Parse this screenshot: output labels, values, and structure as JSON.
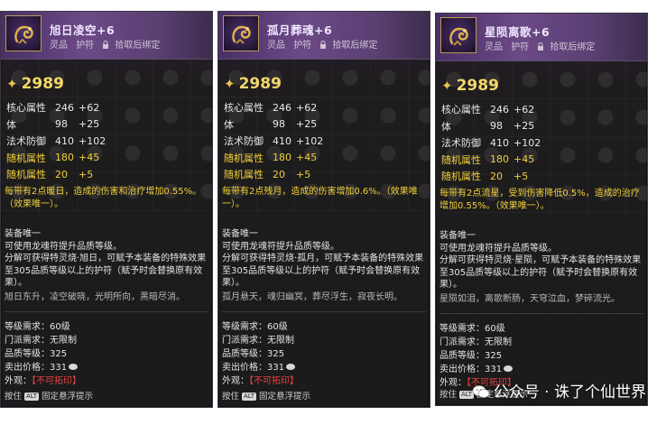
{
  "tooltips": [
    {
      "title": "旭日凌空+6",
      "quality": "灵品",
      "type": "护符",
      "bind": "拾取后绑定",
      "score": "2989",
      "stats": [
        {
          "name": "核心属性",
          "base": "246",
          "plus": "+62"
        },
        {
          "name": "体",
          "base": "98",
          "plus": "+25"
        },
        {
          "name": "法术防御",
          "base": "410",
          "plus": "+102"
        },
        {
          "name": "随机属性",
          "base": "180",
          "plus": "+45"
        },
        {
          "name": "随机属性",
          "base": "20",
          "plus": "+5"
        }
      ],
      "effect": "每带有2点暖日，造成的伤害和治疗增加0.55%。（效果唯一）。",
      "unique_title": "装备唯一",
      "line1": "可使用龙魂符提升品质等级。",
      "line2": "分解可获得特灵烧·旭日，可赋予本装备的特殊效果至305品质等级以上的护符（赋予时会替换原有效果）。",
      "flavor": "旭日东升，凌空破晓，光明所向，黑暗尽消。",
      "level_req": "等级需求：60级",
      "sect_req": "门派需求：无限制",
      "quality_level": "品质等级：",
      "quality_value": "325",
      "sell_price": "卖出价格：",
      "sell_value": "331",
      "appearance": "外观：",
      "appearance_value": "【不可拓印】",
      "footer_press": "按住",
      "footer_key": "ALT",
      "footer_action": "固定悬浮提示"
    },
    {
      "title": "孤月葬魂+6",
      "quality": "灵品",
      "type": "护符",
      "bind": "拾取后绑定",
      "score": "2989",
      "stats": [
        {
          "name": "核心属性",
          "base": "246",
          "plus": "+62"
        },
        {
          "name": "体",
          "base": "98",
          "plus": "+25"
        },
        {
          "name": "法术防御",
          "base": "410",
          "plus": "+102"
        },
        {
          "name": "随机属性",
          "base": "180",
          "plus": "+45"
        },
        {
          "name": "随机属性",
          "base": "20",
          "plus": "+5"
        }
      ],
      "effect": "每带有2点残月，造成的伤害增加0.6%。（效果唯一）。",
      "unique_title": "装备唯一",
      "line1": "可使用龙魂符提升品质等级。",
      "line2": "分解可获得特灵烧·孤月，可赋予本装备的特殊效果至305品质等级以上的护符（赋予时会替换原有效果）。",
      "flavor": "孤月悬天，魂归幽冥，葬尽浮生，寂夜长明。",
      "level_req": "等级需求：60级",
      "sect_req": "门派需求：无限制",
      "quality_level": "品质等级：",
      "quality_value": "325",
      "sell_price": "卖出价格：",
      "sell_value": "331",
      "appearance": "外观：",
      "appearance_value": "【不可拓印】",
      "footer_press": "按住",
      "footer_key": "ALT",
      "footer_action": "固定悬浮提示"
    },
    {
      "title": "星陨离歌+6",
      "quality": "灵品",
      "type": "护符",
      "bind": "拾取后绑定",
      "score": "2989",
      "stats": [
        {
          "name": "核心属性",
          "base": "246",
          "plus": "+62"
        },
        {
          "name": "体",
          "base": "98",
          "plus": "+25"
        },
        {
          "name": "法术防御",
          "base": "410",
          "plus": "+102"
        },
        {
          "name": "随机属性",
          "base": "180",
          "plus": "+45"
        },
        {
          "name": "随机属性",
          "base": "20",
          "plus": "+5"
        }
      ],
      "effect": "每带有2点流星，受到伤害降低0.5%，造成的治疗增加0.55%。（效果唯一）。",
      "unique_title": "装备唯一",
      "line1": "可使用龙魂符提升品质等级。",
      "line2": "分解可获得特灵烧·星陨，可赋予本装备的特殊效果至305品质等级以上的护符（赋予时会替换原有效果）。",
      "flavor": "星陨如泪，离歌断肠，天穹泣血，梦碎流光。",
      "level_req": "等级需求：60级",
      "sect_req": "门派需求：无限制",
      "quality_level": "品质等级：",
      "quality_value": "325",
      "sell_price": "卖出价格：",
      "sell_value": "331",
      "appearance": "外观：",
      "appearance_value": "【不可拓印】",
      "footer_press": "按住",
      "footer_key": "ALT",
      "footer_action": "固定悬浮提示"
    }
  ],
  "watermark": "公众号 · 诛了个仙世界",
  "colors": {
    "yellow": "#f0d03a",
    "red": "#e8413c",
    "gold": "#f2d86a",
    "header_purple": "#6c4a86"
  },
  "icons": {
    "item": "golden-dragon-amulet-icon",
    "score": "star-icon",
    "bind": "lock-icon",
    "coin": "coin-icon",
    "watermark": "wechat-icon"
  }
}
